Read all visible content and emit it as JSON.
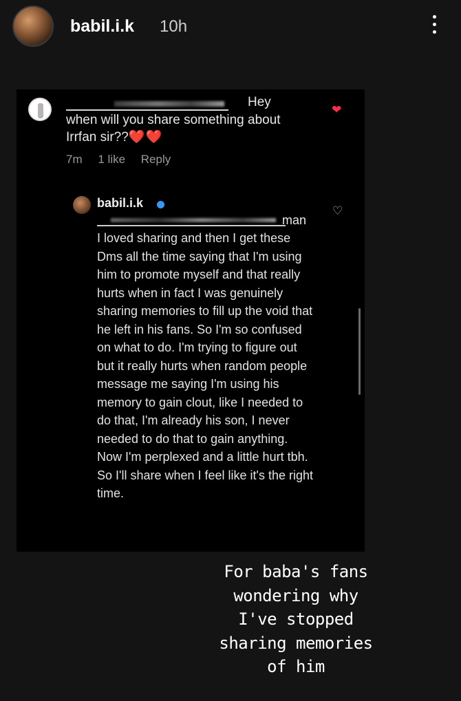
{
  "story": {
    "username": "babil.i.k",
    "time": "10h",
    "more_icon": "more-vertical-icon"
  },
  "comment": {
    "greeting": "Hey",
    "text": "when will you share something about Irrfan sir??",
    "hearts": "❤️❤️",
    "age": "7m",
    "likes": "1 like",
    "reply_label": "Reply",
    "liked": true
  },
  "reply": {
    "username": "babil.i.k",
    "mention_suffix": "man",
    "text": "I loved sharing and then I get these Dms all the time saying that I'm using him to promote myself and that really hurts when in fact I was genuinely sharing memories to fill up the void that he left in his fans. So I'm so confused on what to do. I'm trying to figure out but it really hurts when random people message me saying I'm using his memory to gain clout, like I needed to do that, I'm already his son, I never needed to do that to gain anything. Now I'm perplexed and a little hurt tbh. So I'll share when I feel like it's the right time."
  },
  "caption": {
    "lines": [
      "For baba's fans",
      "wondering why",
      "I've stopped",
      "sharing memories",
      "of him"
    ]
  },
  "colors": {
    "background": "#141414",
    "like_red": "#ff2d45",
    "verified_blue": "#3897f0"
  }
}
